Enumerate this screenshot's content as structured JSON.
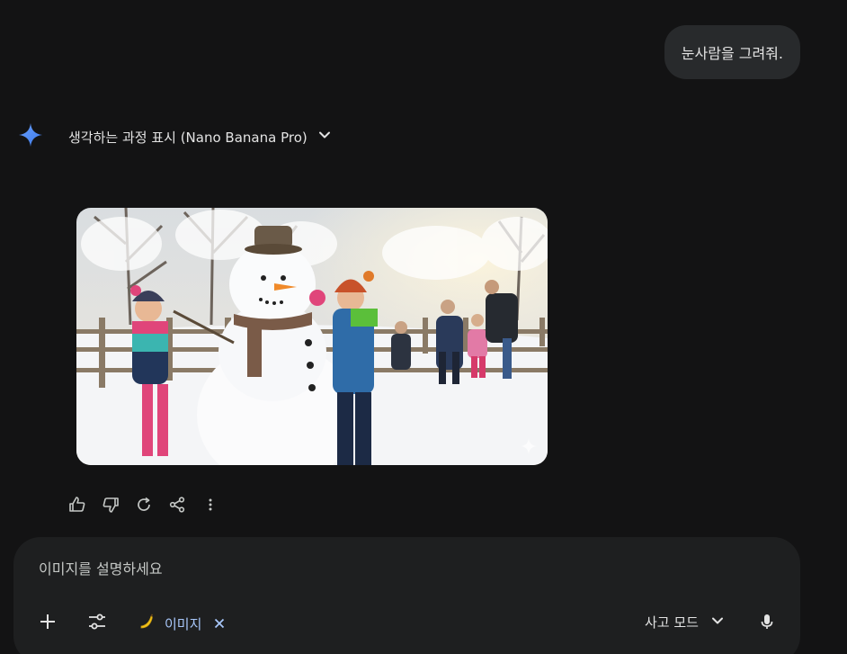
{
  "conversation": {
    "user_message": "눈사람을 그려줘.",
    "model_header": {
      "thinking_label": "생각하는 과정 표시 (Nano Banana Pro)",
      "expand_icon": "chevron-down-icon"
    },
    "image_icons": [
      "gemini-spark-icon",
      "watermark-spark-icon"
    ]
  },
  "action_bar": {
    "icons": [
      "thumb-up-icon",
      "thumb-down-icon",
      "redo-icon",
      "share-icon",
      "more-vert-icon"
    ]
  },
  "composer": {
    "placeholder": "이미지를 설명하세요",
    "tool_chip": {
      "label": "이미지",
      "icon": "banana-icon",
      "remove_icon": "close-icon"
    },
    "mode_label": "사고 모드",
    "icons": [
      "plus-icon",
      "tools-icon",
      "chevron-down-icon",
      "mic-icon"
    ]
  },
  "colors": {
    "background": "#131314",
    "bubble": "#282a2c",
    "composer": "#1e1f20",
    "accent": "#a8c7fa",
    "spark": "#4a8cf7"
  }
}
